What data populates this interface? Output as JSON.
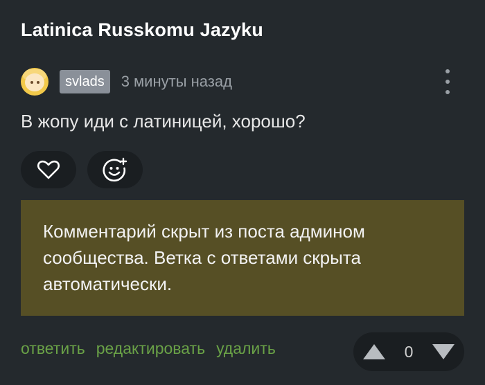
{
  "post": {
    "title": "Latinica Russkomu Jazyku"
  },
  "comment": {
    "username": "svlads",
    "timestamp": "3 минуты назад",
    "text": "В жопу иди с латиницей, хорошо?"
  },
  "hidden_notice": {
    "text": "Комментарий скрыт из поста админом сообщества. Ветка с ответами скрыта автоматически."
  },
  "actions": {
    "reply": "ответить",
    "edit": "редактировать",
    "delete": "удалить"
  },
  "vote": {
    "count": "0"
  },
  "colors": {
    "background": "#24292d",
    "notice_bg": "#564f25",
    "action_link": "#6aa247",
    "username_bg": "#8a9099"
  },
  "icons": {
    "more": "more-vertical-icon",
    "like": "heart-icon",
    "add_reaction": "add-reaction-icon",
    "upvote": "triangle-up-icon",
    "downvote": "triangle-down-icon"
  }
}
